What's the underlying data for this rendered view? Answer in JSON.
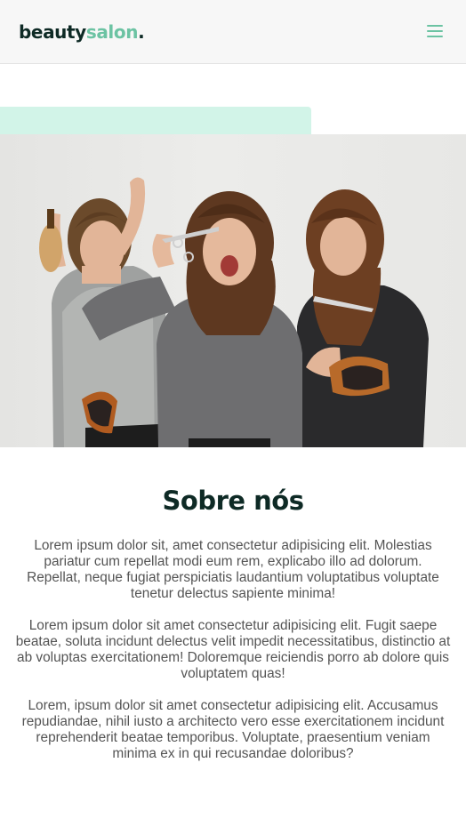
{
  "header": {
    "logo": {
      "part1": "beauty",
      "part2": "salon",
      "part3": "."
    },
    "menu_icon": "hamburger-menu-icon"
  },
  "colors": {
    "brand_dark": "#0e2a25",
    "brand_accent": "#6cc3a3",
    "accent_bar": "#d2f4e8",
    "body_text": "#545454"
  },
  "hero": {
    "image": "three-hairdressers-holding-scissors-and-brushes"
  },
  "about": {
    "title": "Sobre nós",
    "paragraphs": [
      "Lorem ipsum dolor sit, amet consectetur adipisicing elit. Molestias pariatur cum repellat modi eum rem, explicabo illo ad dolorum. Repellat, neque fugiat perspiciatis laudantium voluptatibus voluptate tenetur delectus sapiente minima!",
      "Lorem ipsum dolor sit amet consectetur adipisicing elit. Fugit saepe beatae, soluta incidunt delectus velit impedit necessitatibus, distinctio at ab voluptas exercitationem! Doloremque reiciendis porro ab dolore quis voluptatem quas!",
      "Lorem, ipsum dolor sit amet consectetur adipisicing elit. Accusamus repudiandae, nihil iusto a architecto vero esse exercitationem incidunt reprehenderit beatae temporibus. Voluptate, praesentium veniam minima ex in qui recusandae doloribus?"
    ]
  }
}
